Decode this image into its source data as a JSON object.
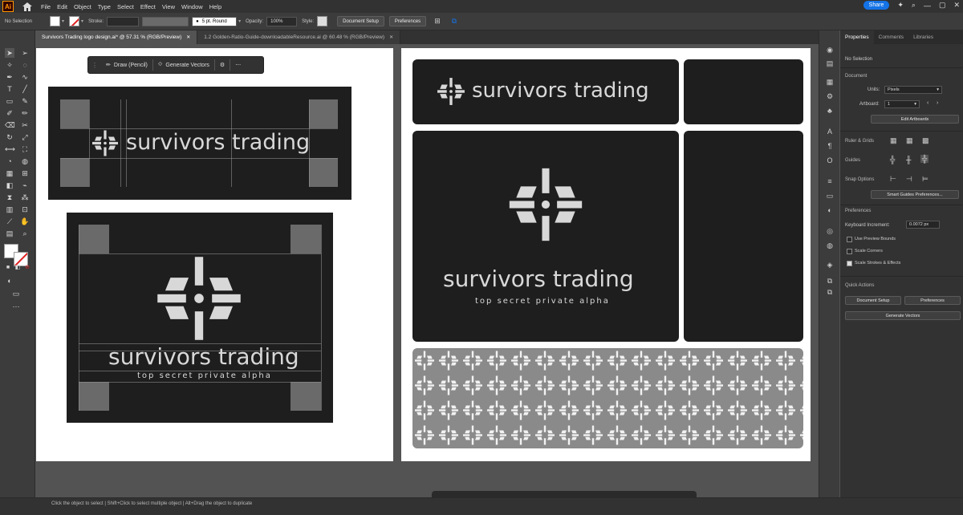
{
  "app": {
    "logo": "Ai",
    "share_label": "Share"
  },
  "menu": [
    "File",
    "Edit",
    "Object",
    "Type",
    "Select",
    "Effect",
    "View",
    "Window",
    "Help"
  ],
  "control": {
    "selection": "No Selection",
    "stroke_label": "Stroke:",
    "brush_label": "5 pt. Round",
    "opacity_label": "Opacity:",
    "opacity_value": "100%",
    "style_label": "Style:",
    "document_setup": "Document Setup",
    "preferences": "Preferences"
  },
  "tabs": [
    {
      "label": "Survivors Trading logo design.ai* @ 57.31 % (RGB/Preview)",
      "active": true
    },
    {
      "label": "1.2 Golden-Ratio-Guide-downloadableResource.ai @ 60.48 % (RGB/Preview)",
      "active": false
    }
  ],
  "floatbar": {
    "draw_label": "Draw (Pencil)",
    "generate_label": "Generate Vectors"
  },
  "artwork": {
    "brand": "survivors trading",
    "tagline": "top secret private alpha"
  },
  "panel": {
    "tabs": [
      "Properties",
      "Comments",
      "Libraries"
    ],
    "selection": "No Selection",
    "document_header": "Document",
    "units_label": "Units:",
    "units_value": "Pixels",
    "artboard_label": "Artboard:",
    "artboard_value": "1",
    "edit_artboards": "Edit Artboards",
    "ruler_grids": "Ruler & Grids",
    "guides": "Guides",
    "snap_options": "Snap Options",
    "smart_guides_prefs": "Smart Guides Preferences...",
    "preferences_header": "Preferences",
    "keyboard_increment_label": "Keyboard Increment:",
    "keyboard_increment_value": "0.0072 px",
    "use_preview_bounds": "Use Preview Bounds",
    "scale_corners": "Scale Corners",
    "scale_strokes": "Scale Strokes & Effects",
    "quick_actions": "Quick Actions",
    "qa_document_setup": "Document Setup",
    "qa_preferences": "Preferences",
    "qa_generate_vectors": "Generate Vectors"
  },
  "status": {
    "hint": "Click the object to select  |  Shift+Click to select multiple object  |  Alt+Drag the object to duplicate"
  },
  "colors": {
    "accent": "#1473e6",
    "artwork_bg": "#1e1e1e",
    "artwork_fg": "#d8d8d8"
  }
}
